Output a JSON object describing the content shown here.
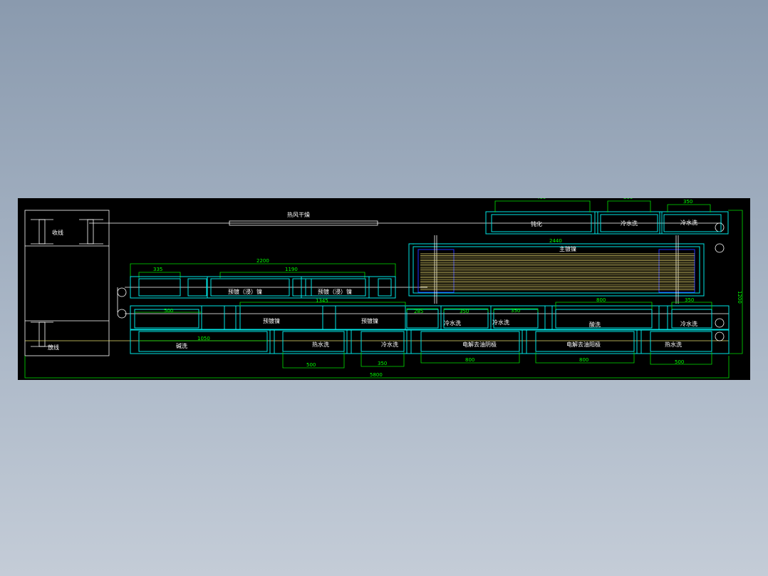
{
  "colors": {
    "background": "#8a9aae",
    "canvas": "#000000",
    "tank_outline": "#00e5e5",
    "dimension": "#00ff00",
    "label": "#ffffff",
    "coil_lines": "#e8d870",
    "anode": "#2030ff"
  },
  "labels": {
    "take_up": "收线",
    "pay_off": "放线",
    "hot_air_dry": "热风干燥",
    "passivation": "钝化",
    "cold_wash_top1": "冷水洗",
    "cold_wash_top2": "冷水洗",
    "main_plating": "主镀镍",
    "preplate_dip_1": "预镀（浸）镍",
    "preplate_dip_2": "预镀（浸）镍",
    "preplate_1": "预镀镍",
    "preplate_2": "预镀镍",
    "cold_wash_m1": "冷水洗",
    "cold_wash_m2": "冷水洗",
    "acid_wash": "酸洗",
    "cold_wash_m3": "冷水洗",
    "alkali_wash": "碱洗",
    "hot_wash_1": "热水洗",
    "cold_wash_b1": "冷水洗",
    "electrolytic_degrease_1": "电解去油阴极",
    "electrolytic_degrease_2": "电解去油阳极",
    "hot_wash_2": "热水洗"
  },
  "dimensions": {
    "passivation_len": "400",
    "cold_wash_top1_len": "300",
    "cold_wash_top2_len": "350",
    "main_plating_len": "2440",
    "height_total": "1200",
    "preplate_dip_total": "2200",
    "preplate_dip_a": "335",
    "preplate_dip_b": "1190",
    "preplate_total": "1345",
    "alkali_a": "500",
    "alkali_b": "1050",
    "mid_a": "285",
    "mid_b": "350",
    "mid_c": "350",
    "acid_wash_len": "800",
    "cold_wash_m3_len": "350",
    "hot_wash_1_len": "500",
    "cold_wash_b1_len": "350",
    "degrease_1_len": "800",
    "degrease_2_len": "800",
    "hot_wash_2_len": "500",
    "overall_len": "5800"
  }
}
